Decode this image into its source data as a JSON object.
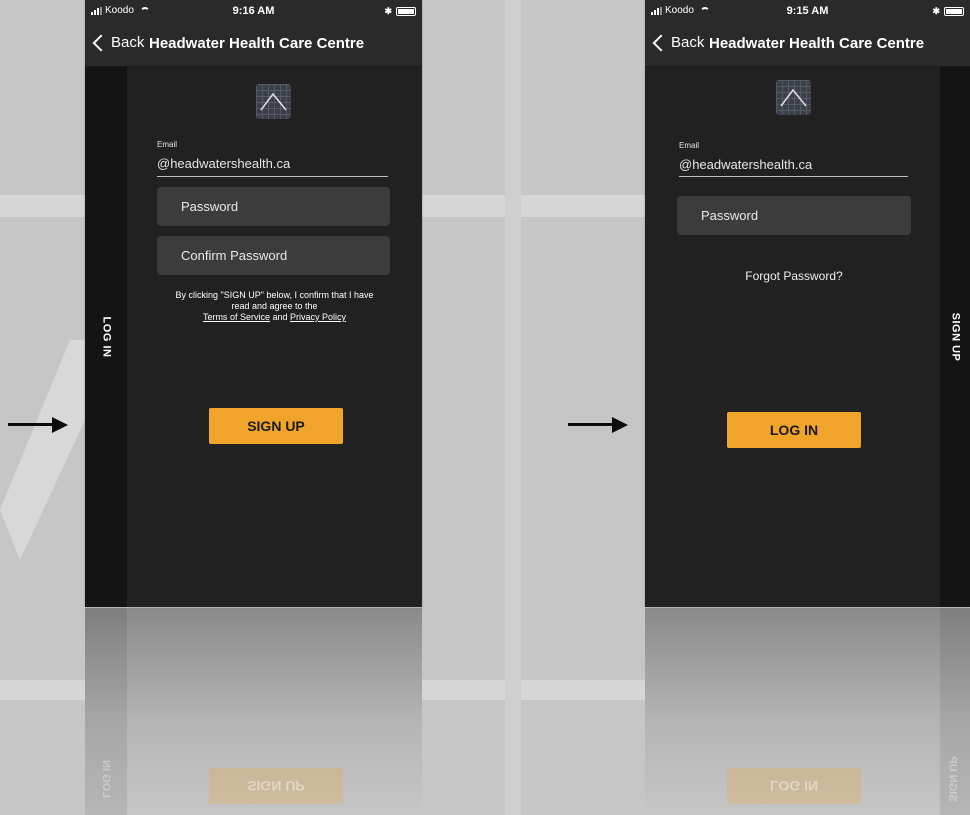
{
  "screens": [
    {
      "status": {
        "carrier": "Koodo",
        "time": "9:16 AM"
      },
      "nav": {
        "back": "Back",
        "title": "Headwater Health Care Centre"
      },
      "side_tab": "LOG IN",
      "email_label": "Email",
      "email_value": "@headwatershealth.ca",
      "password_placeholder": "Password",
      "confirm_placeholder": "Confirm Password",
      "terms": {
        "line1": "By clicking \"SIGN UP\" below, I confirm that I have",
        "line2": "read and agree to the",
        "tos": "Terms of Service",
        "and": "and",
        "privacy": "Privacy Policy"
      },
      "cta": "SIGN UP"
    },
    {
      "status": {
        "carrier": "Koodo",
        "time": "9:15 AM"
      },
      "nav": {
        "back": "Back",
        "title": "Headwater Health Care Centre"
      },
      "side_tab": "SIGN UP",
      "email_label": "Email",
      "email_value": "@headwatershealth.ca",
      "password_placeholder": "Password",
      "forgot": "Forgot Password?",
      "cta": "LOG IN"
    }
  ],
  "icons": {
    "signal": "signal-bars-icon",
    "wifi": "wifi-icon",
    "bluetooth": "bluetooth-icon",
    "battery": "battery-icon",
    "back": "chevron-left-icon",
    "logo": "app-logo-icon",
    "arrow": "arrow-right-icon"
  },
  "colors": {
    "phone_background": "#212121",
    "side_tab": "#141414",
    "input_background": "#3c3c3c",
    "accent": "#f0a52a",
    "page_background": "#c6c6c6"
  }
}
